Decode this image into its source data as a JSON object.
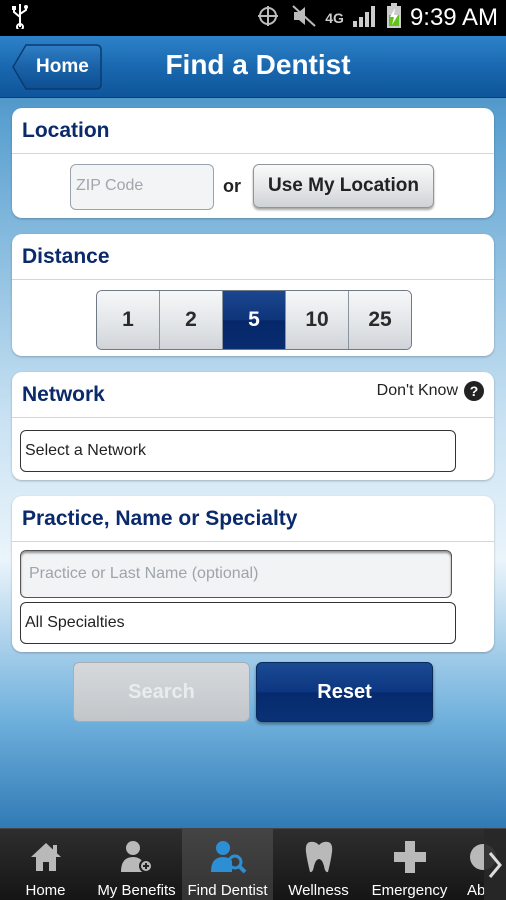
{
  "status_bar": {
    "time": "9:39 AM",
    "network": "4G",
    "icons": [
      "usb-icon",
      "location-icon",
      "mute-icon",
      "network-4g-icon",
      "signal-icon",
      "battery-charging-icon"
    ]
  },
  "header": {
    "home_label": "Home",
    "title": "Find a Dentist"
  },
  "location": {
    "title": "Location",
    "zip_placeholder": "ZIP Code",
    "or_label": "or",
    "use_location_label": "Use My Location"
  },
  "distance": {
    "title": "Distance",
    "options": [
      "1",
      "2",
      "5",
      "10",
      "25"
    ],
    "selected": "5"
  },
  "network": {
    "title": "Network",
    "dont_know_label": "Don't Know",
    "select_value": "Select a Network"
  },
  "practice": {
    "title": "Practice, Name or Specialty",
    "name_placeholder": "Practice or Last Name (optional)",
    "specialty_value": "All Specialties"
  },
  "actions": {
    "search_label": "Search",
    "reset_label": "Reset"
  },
  "tabs": [
    {
      "label": "Home",
      "icon": "home-icon"
    },
    {
      "label": "My Benefits",
      "icon": "my-benefits-icon"
    },
    {
      "label": "Find Dentist",
      "icon": "find-dentist-icon",
      "active": true
    },
    {
      "label": "Wellness",
      "icon": "tooth-icon"
    },
    {
      "label": "Emergency",
      "icon": "medical-cross-icon"
    },
    {
      "label": "Ab",
      "icon": "about-icon"
    }
  ],
  "colors": {
    "accent_navy": "#0a2a6b",
    "header_blue": "#1866ad",
    "selected_segment": "#0e3479"
  }
}
